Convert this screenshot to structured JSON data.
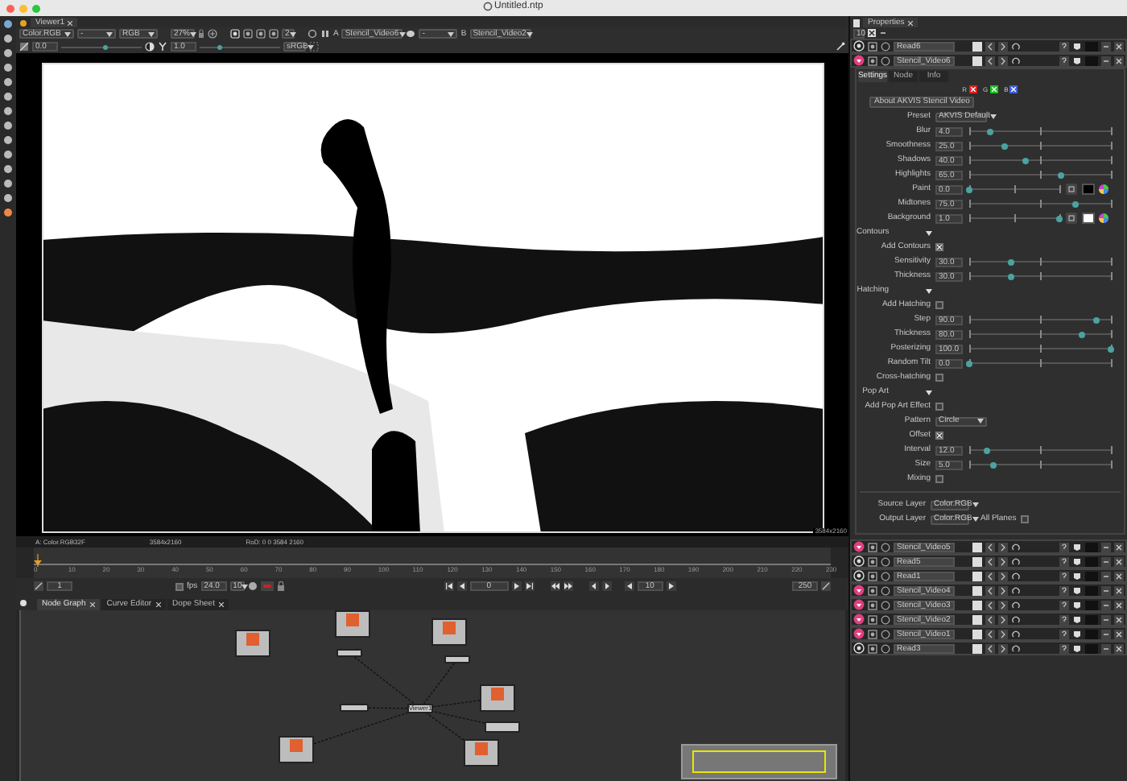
{
  "window": {
    "title": "Untitled.ntp"
  },
  "viewer": {
    "tab": "Viewer1",
    "channels": "Color.RGB",
    "alpha": "-",
    "display": "RGB",
    "zoom": "27%",
    "subsample": "2",
    "input_a_label": "A",
    "input_a": "Stencil_Video6",
    "operation": "-",
    "input_b_label": "B",
    "input_b": "Stencil_Video2",
    "gain": {
      "value": "0.0",
      "level": 0.55
    },
    "gamma": {
      "value": "1.0",
      "level": 0.25
    },
    "colorspace": "sRGB",
    "resolution": "3584x2160"
  },
  "info_bar": [
    "A: Color.RGB32F",
    "3584x2160",
    "RoD: 0 0 3584 2160"
  ],
  "timeline": {
    "ticks": [
      "0",
      "10",
      "20",
      "30",
      "40",
      "50",
      "60",
      "70",
      "80",
      "90",
      "100",
      "110",
      "120",
      "130",
      "140",
      "150",
      "160",
      "170",
      "180",
      "190",
      "200",
      "210",
      "220",
      "230"
    ]
  },
  "playback": {
    "start_frame": "1",
    "fps_label": "fps",
    "fps_enabled": false,
    "fps": "24.0",
    "dropdown": "10",
    "current_frame": "0",
    "increment": "10",
    "end_frame": "250"
  },
  "node_graph": {
    "tabs": [
      {
        "label": "Node Graph",
        "selected": true
      },
      {
        "label": "Curve Editor",
        "selected": false
      },
      {
        "label": "Dope Sheet",
        "selected": false
      }
    ],
    "nodes": [
      {
        "kind": "read"
      },
      {
        "kind": "read"
      },
      {
        "kind": "read"
      },
      {
        "kind": "stencil"
      },
      {
        "kind": "stencil"
      },
      {
        "kind": "stencil"
      },
      {
        "kind": "viewer",
        "label": "Viewer1"
      },
      {
        "kind": "read"
      },
      {
        "kind": "stencil"
      },
      {
        "kind": "read"
      },
      {
        "kind": "read"
      }
    ]
  },
  "properties": {
    "tab": "Properties",
    "max_panels": "10",
    "open_nodes": [
      {
        "name": "Read6",
        "kind": "read"
      },
      {
        "name": "Stencil_Video6",
        "kind": "stencil"
      }
    ],
    "tabs": [
      {
        "label": "Settings",
        "selected": true
      },
      {
        "label": "Node",
        "selected": false
      },
      {
        "label": "Info",
        "selected": false
      }
    ],
    "channels": [
      {
        "label": "R",
        "checked": true,
        "color": "#e02020"
      },
      {
        "label": "G",
        "checked": true,
        "color": "#20c020"
      },
      {
        "label": "B",
        "checked": true,
        "color": "#4060e0"
      }
    ],
    "about_button": "About AKVIS Stencil Video",
    "params": [
      {
        "kind": "choice",
        "label": "Preset",
        "value": "AKVIS Default"
      },
      {
        "kind": "slider",
        "label": "Blur",
        "value": "4.0",
        "level": 0.15
      },
      {
        "kind": "slider",
        "label": "Smoothness",
        "value": "25.0",
        "level": 0.25
      },
      {
        "kind": "slider",
        "label": "Shadows",
        "value": "40.0",
        "level": 0.4
      },
      {
        "kind": "slider",
        "label": "Highlights",
        "value": "65.0",
        "level": 0.65
      },
      {
        "kind": "slider",
        "label": "Paint",
        "value": "0.0",
        "level": 0,
        "color": "#000000"
      },
      {
        "kind": "slider",
        "label": "Midtones",
        "value": "75.0",
        "level": 0.75
      },
      {
        "kind": "slider",
        "label": "Background",
        "value": "1.0",
        "level": 1,
        "color": "#ffffff"
      },
      {
        "kind": "group",
        "label": "Contours",
        "expanded": true
      },
      {
        "kind": "checkbox",
        "label": "Add Contours",
        "checked": true
      },
      {
        "kind": "slider",
        "label": "Sensitivity",
        "value": "30.0",
        "level": 0.3
      },
      {
        "kind": "slider",
        "label": "Thickness",
        "value": "30.0",
        "level": 0.3
      },
      {
        "kind": "group",
        "label": "Hatching",
        "expanded": true
      },
      {
        "kind": "checkbox",
        "label": "Add Hatching",
        "checked": false
      },
      {
        "kind": "slider",
        "label": "Step",
        "value": "90.0",
        "level": 0.9
      },
      {
        "kind": "slider",
        "label": "Thickness",
        "value": "80.0",
        "level": 0.8
      },
      {
        "kind": "slider",
        "label": "Posterizing",
        "value": "100.0",
        "level": 1
      },
      {
        "kind": "slider",
        "label": "Random Tilt",
        "value": "0.0",
        "level": 0
      },
      {
        "kind": "checkbox",
        "label": "Cross-hatching",
        "checked": false
      },
      {
        "kind": "group",
        "label": "Pop Art",
        "expanded": true
      },
      {
        "kind": "checkbox",
        "label": "Add Pop Art Effect",
        "checked": false
      },
      {
        "kind": "choice",
        "label": "Pattern",
        "value": "Circle"
      },
      {
        "kind": "checkbox",
        "label": "Offset",
        "checked": true
      },
      {
        "kind": "slider",
        "label": "Interval",
        "value": "12.0",
        "level": 0.12
      },
      {
        "kind": "slider",
        "label": "Size",
        "value": "5.0",
        "level": 0.17
      },
      {
        "kind": "checkbox",
        "label": "Mixing",
        "checked": false
      }
    ],
    "source_layer": {
      "label": "Source Layer",
      "value": "Color.RGB"
    },
    "output_layer": {
      "label": "Output Layer",
      "value": "Color.RGB",
      "all_planes_label": "All Planes",
      "all_planes": false
    },
    "node_list": [
      {
        "name": "Stencil_Video5",
        "kind": "stencil"
      },
      {
        "name": "Read5",
        "kind": "read"
      },
      {
        "name": "Read1",
        "kind": "read"
      },
      {
        "name": "Stencil_Video4",
        "kind": "stencil"
      },
      {
        "name": "Stencil_Video3",
        "kind": "stencil"
      },
      {
        "name": "Stencil_Video2",
        "kind": "stencil"
      },
      {
        "name": "Stencil_Video1",
        "kind": "stencil"
      },
      {
        "name": "Read3",
        "kind": "read"
      }
    ]
  }
}
